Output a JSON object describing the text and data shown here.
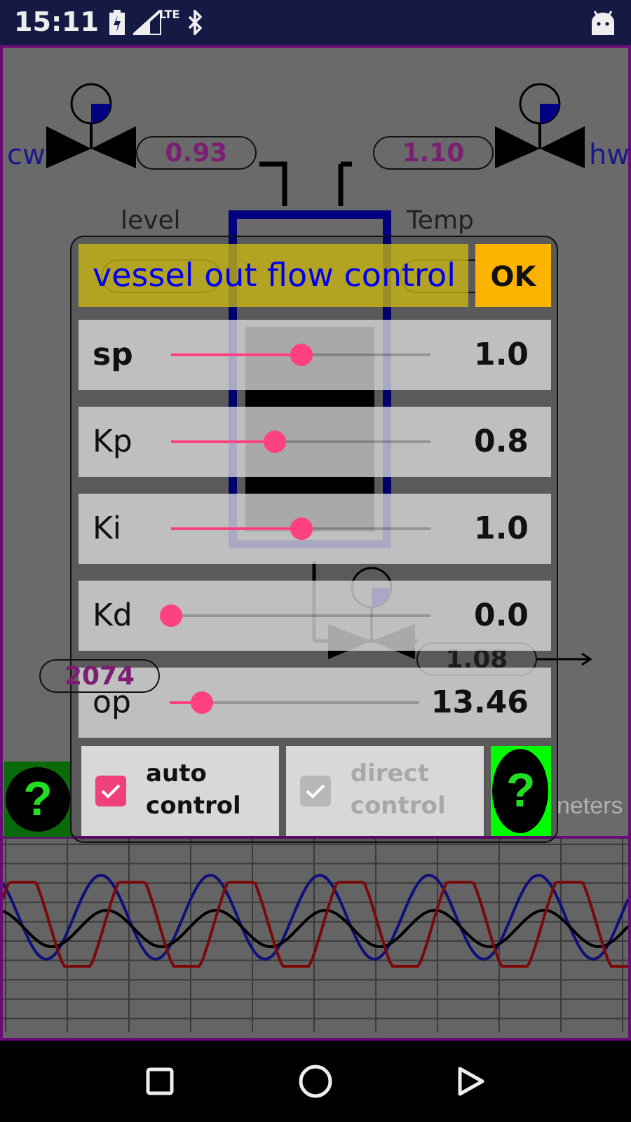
{
  "status_bar": {
    "time": "15:11",
    "network": "LTE"
  },
  "diagram": {
    "inlet_valves": [
      {
        "label": "cw",
        "reading": "0.93"
      },
      {
        "label": "hw",
        "reading": "1.10"
      }
    ],
    "level_label": "level",
    "temp_label": "Temp",
    "left_reading": "2074",
    "outlet_reading": "1.08",
    "hint_fragments": [
      "neters"
    ],
    "help_button": {
      "symbol": "?"
    }
  },
  "dialog": {
    "title": "vessel out flow control",
    "ok": "OK",
    "parameters": [
      {
        "name": "sp",
        "bold": true,
        "level": 0.5,
        "value": "1.0"
      },
      {
        "name": "Kp",
        "bold": false,
        "level": 0.4,
        "value": "0.8"
      },
      {
        "name": "Ki",
        "bold": false,
        "level": 0.5,
        "value": "1.0"
      },
      {
        "name": "Kd",
        "bold": false,
        "level": 0,
        "value": "0.0"
      },
      {
        "name": "op",
        "bold": false,
        "level": 0.13,
        "value": "13.46"
      }
    ],
    "modes": [
      {
        "label": "auto control",
        "checked": true,
        "disabled": false
      },
      {
        "label": "direct control",
        "checked": true,
        "disabled": true
      }
    ],
    "help_button": {
      "symbol": "?"
    }
  }
}
